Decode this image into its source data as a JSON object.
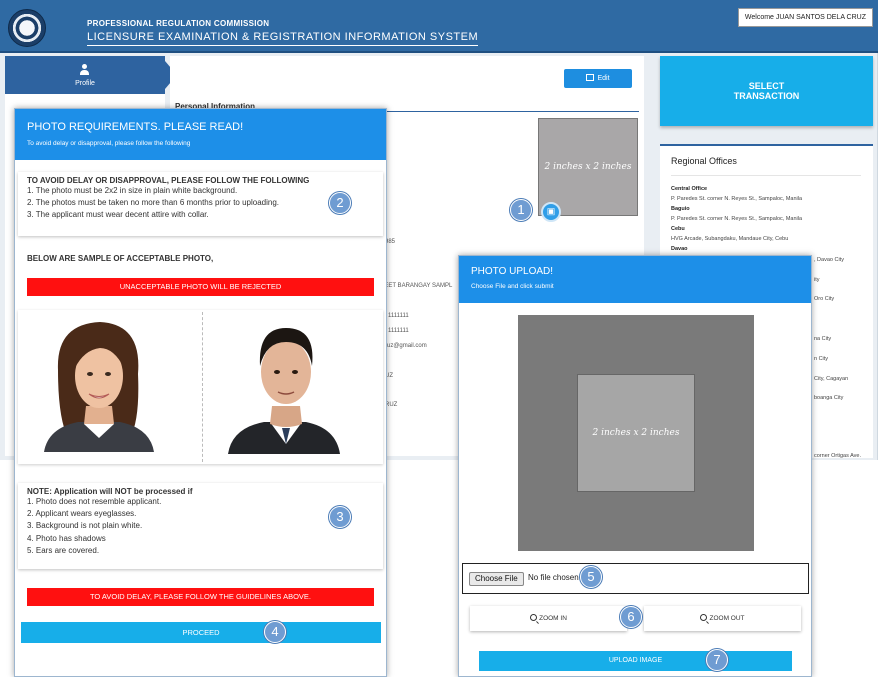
{
  "header": {
    "org_name": "PROFESSIONAL REGULATION COMMISSION",
    "system_name": "LICENSURE EXAMINATION & REGISTRATION INFORMATION SYSTEM",
    "welcome": "Welcome JUAN SANTOS DELA CRUZ"
  },
  "sidebar": {
    "profile_label": "Profile"
  },
  "main": {
    "edit_label": "Edit",
    "section_title": "Personal Information",
    "photo_placeholder": "2 inches x 2 inches",
    "fragments": [
      "985",
      "REET BARANGAY SAMPL",
      "1111111",
      "1111111",
      "cruz@gmail.com",
      "UZ",
      "RUZ"
    ]
  },
  "right_panel": {
    "select_transaction": "SELECT\nTRANSACTION",
    "offices_title": "Regional Offices",
    "offices": [
      {
        "city": "Central Office",
        "address": "P. Paredes St. corner N. Reyes St., Sampaloc, Manila"
      },
      {
        "city": "Baguio",
        "address": "P. Paredes St. corner N. Reyes St., Sampaloc, Manila"
      },
      {
        "city": "Cebu",
        "address": "HVG Arcade, Subangdaku, Mandaue City, Cebu"
      },
      {
        "city": "Davao",
        "address": ""
      }
    ],
    "fragments": [
      ", Davao City",
      "ity",
      "Oro City",
      "na City",
      "n City",
      "City, Cagayan",
      "boanga City",
      "corner Ortigas Ave."
    ]
  },
  "requirements_modal": {
    "title": "PHOTO REQUIREMENTS. PLEASE READ!",
    "subtitle": "To avoid delay or disapproval, please follow the following",
    "rules_heading": "TO AVOID DELAY OR DISAPPROVAL, PLEASE FOLLOW THE FOLLOWING",
    "rules": [
      "1. The photo must be 2x2 in size in plain white background.",
      "2. The photos must be taken no more than 6 months prior to uploading.",
      "3. The applicant must wear decent attire with collar."
    ],
    "samples_heading": "BELOW ARE SAMPLE OF ACCEPTABLE PHOTO,",
    "warning_banner": "UNACCEPTABLE PHOTO WILL BE REJECTED",
    "note_heading": "NOTE: Application will NOT be processed if",
    "notes": [
      "1. Photo does not resemble applicant.",
      "2. Applicant wears eyeglasses.",
      "3. Background is not plain white.",
      "4. Photo has shadows",
      "5. Ears are covered."
    ],
    "guideline_banner": "TO AVOID DELAY, PLEASE FOLLOW THE GUIDELINES ABOVE.",
    "proceed_label": "PROCEED"
  },
  "upload_modal": {
    "title": "PHOTO UPLOAD!",
    "subtitle": "Choose File and click submit",
    "crop_label": "2 inches x 2 inches",
    "choose_file_label": "Choose File",
    "file_status": "No file chosen",
    "zoom_in_label": "ZOOM IN",
    "zoom_out_label": "ZOOM OUT",
    "upload_label": "UPLOAD IMAGE"
  },
  "callouts": [
    "1",
    "2",
    "3",
    "4",
    "5",
    "6",
    "7"
  ],
  "colors": {
    "header_blue": "#2f6aa3",
    "modal_blue": "#1d8fe8",
    "button_cyan": "#17aee9",
    "warning_red": "#ff1010",
    "callout_blue": "#6f9cd2"
  },
  "icons": [
    "seal-logo",
    "user-icon",
    "edit-icon",
    "camera-icon",
    "zoom-in-icon",
    "zoom-out-icon"
  ]
}
